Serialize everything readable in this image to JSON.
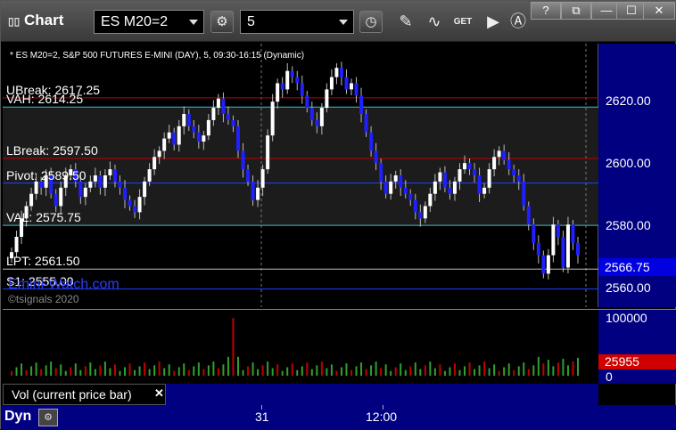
{
  "app": {
    "icon": "chart-grid-icon",
    "title": "Chart"
  },
  "toolbar": {
    "symbol": "ES M20=2",
    "interval": "5",
    "buttons": [
      "settings-gear-icon",
      "clock-icon",
      "pencil-draw-icon",
      "indicator-wave-icon",
      "get-data-icon",
      "play-icon",
      "annotation-a-icon"
    ]
  },
  "window_buttons": {
    "help": "?",
    "link": "⧉",
    "minimize": "—",
    "maximize": "☐",
    "close": "✕"
  },
  "chart": {
    "header": "* ES M20=2, S&P 500 FUTURES E-MINI (DAY), 5, 09:30-16:15 (Dynamic)",
    "y_ticks": [
      "2620.00",
      "2600.00",
      "2580.00",
      "2560.00"
    ],
    "last_price": "2566.75",
    "levels": [
      {
        "label": "UBreak: 2617.25",
        "color": "#c00000"
      },
      {
        "label": "VAH: 2614.25",
        "color": "#40c0c0"
      },
      {
        "label": "LBreak: 2597.50",
        "color": "#c00000"
      },
      {
        "label": "Pivot: 2589.50",
        "color": "#2040ff"
      },
      {
        "label": "VAL: 2575.75",
        "color": "#40c0c0"
      },
      {
        "label": "LPT: 2561.50",
        "color": "#c0c0c0"
      },
      {
        "label": "S1: 2555.00",
        "color": "#2040ff"
      }
    ],
    "watermark": "Emini-Watch.com",
    "bottom_note": "©tsignals 2020"
  },
  "chart_data": {
    "type": "candlestick",
    "ylim": [
      2552,
      2632
    ],
    "y_ticks": [
      2560,
      2580,
      2600,
      2620
    ],
    "levels": [
      2617.25,
      2614.25,
      2597.5,
      2589.5,
      2575.75,
      2561.5,
      2555.0
    ],
    "close": [
      2567,
      2572,
      2578,
      2582,
      2586,
      2590,
      2588,
      2592,
      2586,
      2582,
      2588,
      2592,
      2594,
      2590,
      2585,
      2588,
      2590,
      2592,
      2588,
      2592,
      2594,
      2590,
      2588,
      2584,
      2582,
      2580,
      2585,
      2590,
      2594,
      2598,
      2600,
      2604,
      2606,
      2602,
      2608,
      2612,
      2608,
      2606,
      2603,
      2605,
      2610,
      2614,
      2617,
      2612,
      2610,
      2608,
      2600,
      2594,
      2590,
      2584,
      2588,
      2594,
      2605,
      2616,
      2622,
      2620,
      2626,
      2624,
      2622,
      2618,
      2614,
      2610,
      2608,
      2614,
      2620,
      2624,
      2627,
      2624,
      2620,
      2622,
      2618,
      2612,
      2606,
      2600,
      2596,
      2590,
      2586,
      2590,
      2592,
      2588,
      2586,
      2584,
      2580,
      2578,
      2582,
      2586,
      2590,
      2593,
      2588,
      2586,
      2590,
      2594,
      2596,
      2594,
      2592,
      2586,
      2588,
      2594,
      2598,
      2600,
      2597,
      2594,
      2592,
      2590,
      2582,
      2576,
      2570,
      2566,
      2560,
      2566,
      2576,
      2572,
      2562,
      2576,
      2570,
      2566
    ],
    "volume_max": 100000,
    "volume_current": 25955
  },
  "volume": {
    "y_ticks": [
      "100000",
      "0"
    ],
    "current": "25955"
  },
  "indicator": {
    "label": "Vol (current price bar)",
    "close": "✕"
  },
  "time_axis": {
    "left_label": "Dyn",
    "icon": "lock-settings-icon",
    "labels": [
      "31",
      "12:00"
    ]
  }
}
